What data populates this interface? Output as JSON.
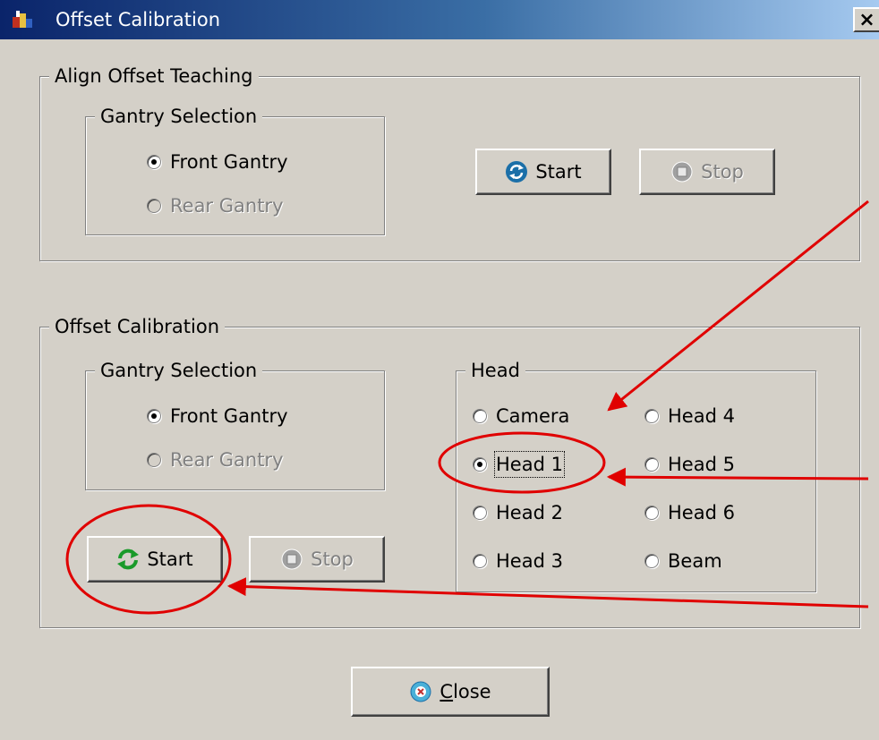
{
  "window": {
    "title": "Offset Calibration",
    "close_glyph": "×"
  },
  "align_group": {
    "label": "Align Offset Teaching",
    "gantry": {
      "label": "Gantry Selection",
      "front": "Front Gantry",
      "rear": "Rear Gantry",
      "selected": "Front Gantry"
    },
    "start_label": "Start",
    "stop_label": "Stop"
  },
  "offset_group": {
    "label": "Offset Calibration",
    "gantry": {
      "label": "Gantry Selection",
      "front": "Front Gantry",
      "rear": "Rear Gantry",
      "selected": "Front Gantry"
    },
    "head": {
      "label": "Head",
      "options": [
        "Camera",
        "Head 1",
        "Head 2",
        "Head 3",
        "Head 4",
        "Head 5",
        "Head 6",
        "Beam"
      ],
      "selected": "Head 1"
    },
    "start_label": "Start",
    "stop_label": "Stop"
  },
  "close_button": {
    "mnemonic": "C",
    "rest": "lose"
  },
  "icons": {
    "title": "app-icon",
    "align_start": "refresh-icon",
    "align_stop": "stop-icon",
    "offset_start": "green-refresh-icon",
    "offset_stop": "stop-icon",
    "close": "close-icon"
  },
  "colors": {
    "titlebar_start": "#0a246a",
    "titlebar_end": "#a6caf0",
    "face": "#d4d0c8",
    "annotation": "#e00000"
  }
}
